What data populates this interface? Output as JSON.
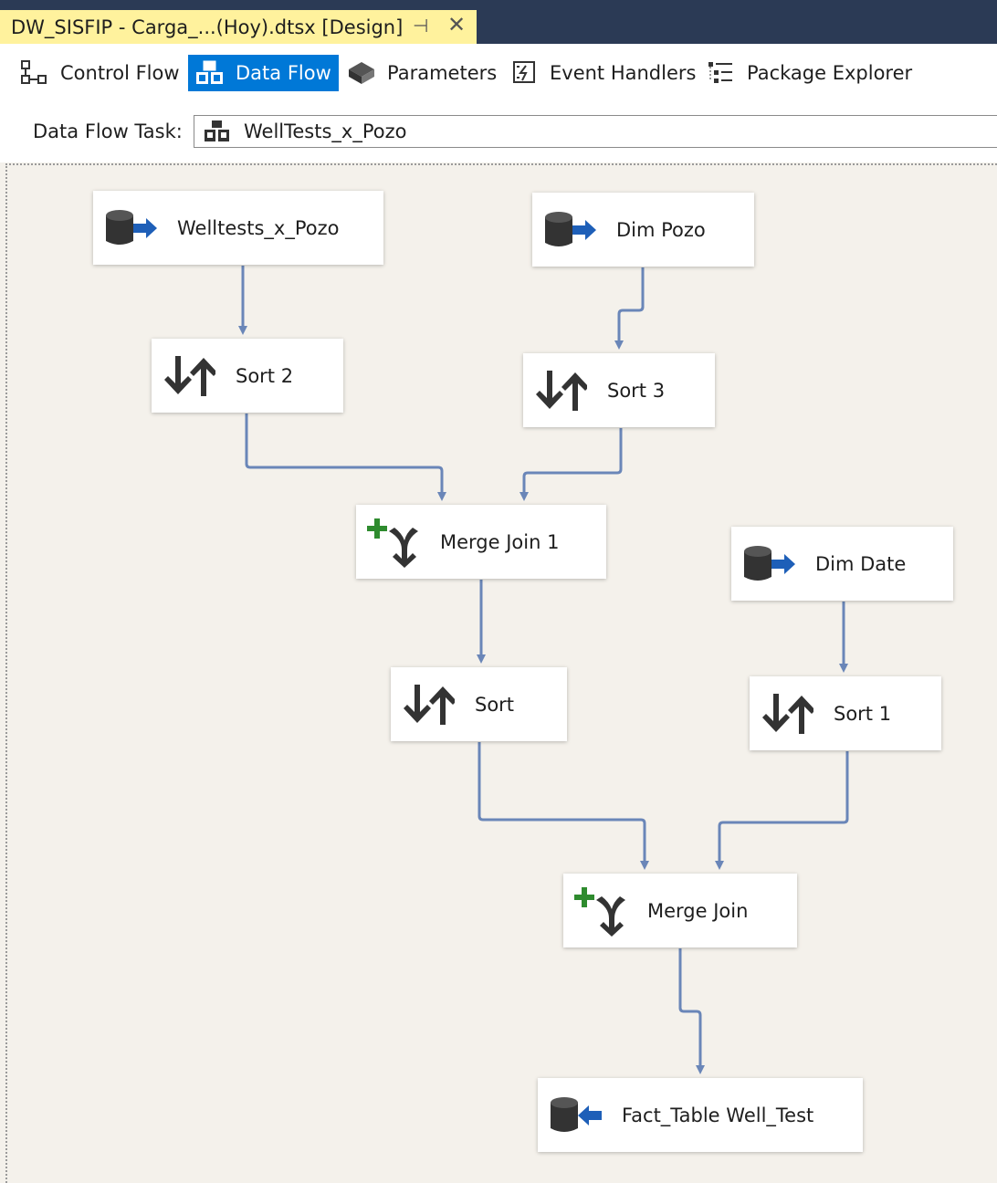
{
  "document_tab": {
    "title": "DW_SISFIP - Carga_...(Hoy).dtsx [Design]",
    "pin_glyph": "⊣",
    "close_glyph": "✕"
  },
  "designer_tabs": [
    {
      "label": "Control Flow",
      "icon": "control-flow-icon",
      "active": false
    },
    {
      "label": "Data Flow",
      "icon": "data-flow-icon",
      "active": true
    },
    {
      "label": "Parameters",
      "icon": "parameters-icon",
      "active": false
    },
    {
      "label": "Event Handlers",
      "icon": "event-handlers-icon",
      "active": false
    },
    {
      "label": "Package Explorer",
      "icon": "package-explorer-icon",
      "active": false
    }
  ],
  "task_selector": {
    "label": "Data Flow Task:",
    "value": "WellTests_x_Pozo"
  },
  "components": [
    {
      "id": "welltests",
      "label": "Welltests_x_Pozo",
      "icon": "ole-db-source-icon"
    },
    {
      "id": "dim-pozo",
      "label": "Dim Pozo",
      "icon": "ole-db-source-icon"
    },
    {
      "id": "sort-2",
      "label": "Sort 2",
      "icon": "sort-icon"
    },
    {
      "id": "sort-3",
      "label": "Sort 3",
      "icon": "sort-icon"
    },
    {
      "id": "merge-join-1",
      "label": "Merge Join 1",
      "icon": "merge-join-icon"
    },
    {
      "id": "dim-date",
      "label": "Dim Date",
      "icon": "ole-db-source-icon"
    },
    {
      "id": "sort",
      "label": "Sort",
      "icon": "sort-icon"
    },
    {
      "id": "sort-1",
      "label": "Sort 1",
      "icon": "sort-icon"
    },
    {
      "id": "merge-join",
      "label": "Merge Join",
      "icon": "merge-join-icon"
    },
    {
      "id": "fact-table",
      "label": "Fact_Table Well_Test",
      "icon": "ole-db-destination-icon"
    }
  ],
  "colors": {
    "active_tab": "#0078d7",
    "document_tab": "#fff29d",
    "connector": "#6a86b8",
    "canvas": "#f4f1eb",
    "plus_green": "#2e8b2e"
  }
}
